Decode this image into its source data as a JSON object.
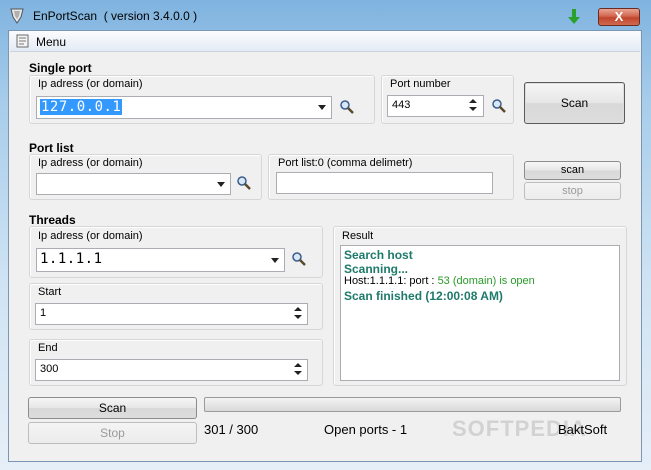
{
  "window": {
    "title": "EnPortScan  ( version 3.4.0.0 )",
    "close_glyph": "X"
  },
  "menu": {
    "label": "Menu"
  },
  "single_port": {
    "group_label": "Single port",
    "ip_label": "Ip adress (or domain)",
    "ip_value": "127.0.0.1",
    "port_label": "Port number",
    "port_value": "443",
    "scan_label": "Scan"
  },
  "port_list": {
    "group_label": "Port list",
    "ip_label": "Ip adress (or domain)",
    "ip_value": "",
    "ports_label": "Port list:0  (comma delimetr)",
    "ports_value": "",
    "scan_label": "scan",
    "stop_label": "stop"
  },
  "threads": {
    "group_label": "Threads",
    "ip_label": "Ip adress (or domain)",
    "ip_value": "1.1.1.1",
    "start_label": "Start",
    "start_value": "1",
    "end_label": "End",
    "end_value": "300",
    "result_label": "Result",
    "result_lines": {
      "l1": "Search host",
      "l2": "Scanning...",
      "l3_prefix": "Host:1.1.1.1: port : ",
      "l3_highlight": "53 (domain)  is open",
      "l4": "Scan finished (12:00:08 AM)"
    },
    "scan_label": "Scan",
    "stop_label": "Stop"
  },
  "status": {
    "progress_count": "301 / 300",
    "open_ports": "Open ports - 1",
    "brand": "BaktSoft",
    "progress_fraction": 0
  },
  "watermark": "SOFTPEDIA",
  "colors": {
    "result_green": "#1e7a6a",
    "open_port_green": "#2a9a2a",
    "selection_blue": "#3399ff"
  }
}
